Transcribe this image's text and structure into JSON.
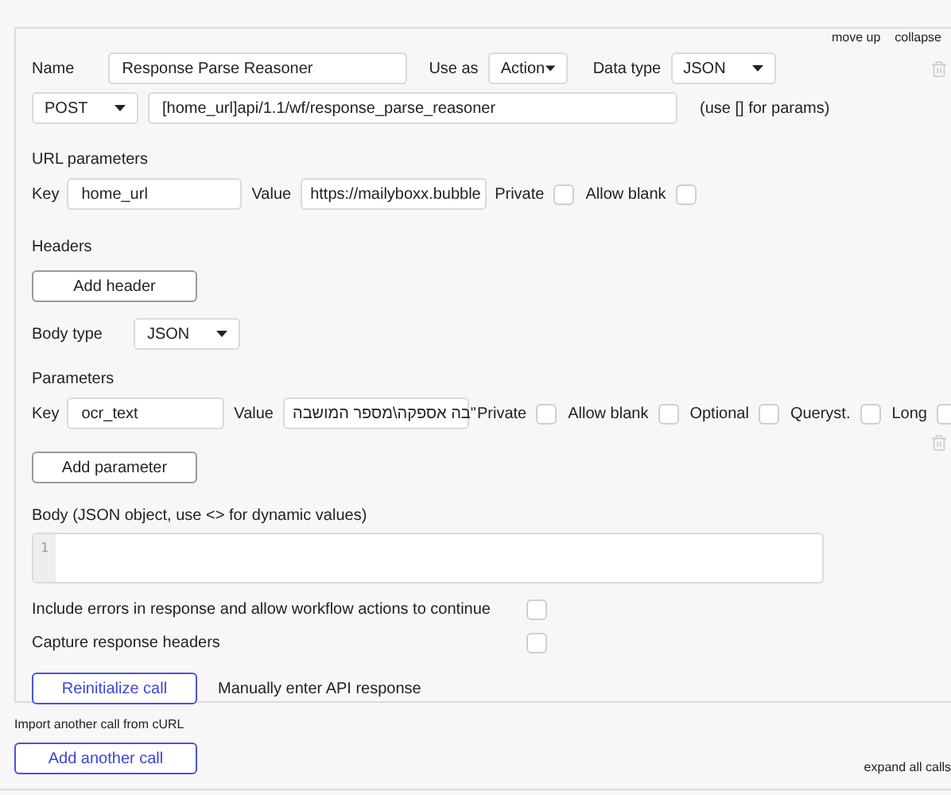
{
  "top_links": [
    "move up",
    "collapse"
  ],
  "call": {
    "name_label": "Name",
    "name": "Response Parse Reasoner",
    "use_as_label": "Use as",
    "use_as": "Action",
    "data_type_label": "Data type",
    "data_type": "JSON",
    "method": "POST",
    "url": "[home_url]api/1.1/wf/response_parse_reasoner",
    "url_hint": "(use [] for params)"
  },
  "url_parameters": {
    "title": "URL parameters",
    "rows": [
      {
        "key_label": "Key",
        "key": "home_url",
        "value_label": "Value",
        "value": "https://mailyboxx.bubble",
        "options": [
          {
            "label": "Private",
            "checked": false
          },
          {
            "label": "Allow blank",
            "checked": false
          }
        ]
      }
    ]
  },
  "headers": {
    "title": "Headers",
    "button": "Add header"
  },
  "body_type": {
    "label": "Body type",
    "value": "JSON"
  },
  "parameters": {
    "title": "Parameters",
    "rows": [
      {
        "key_label": "Key",
        "key": "ocr_text",
        "value_label": "Value",
        "value": "בה אספקה\\מספר המושבה\"",
        "options": [
          {
            "label": "Private",
            "checked": false
          },
          {
            "label": "Allow blank",
            "checked": false
          },
          {
            "label": "Optional",
            "checked": false
          },
          {
            "label": "Queryst.",
            "checked": false
          },
          {
            "label": "Long",
            "checked": false
          }
        ]
      }
    ],
    "button": "Add parameter"
  },
  "body": {
    "label": "Body (JSON object, use <> for dynamic values)",
    "line_numbers": [
      "1"
    ]
  },
  "settings": [
    {
      "label": "Include errors in response and allow workflow actions to continue",
      "checked": false
    },
    {
      "label": "Capture response headers",
      "checked": false
    }
  ],
  "actions": {
    "button": "Reinitialize call",
    "link": "Manually enter API response"
  },
  "import_link": "Import another call from cURL",
  "add_button": "Add another call",
  "expand_link": "expand all calls"
}
